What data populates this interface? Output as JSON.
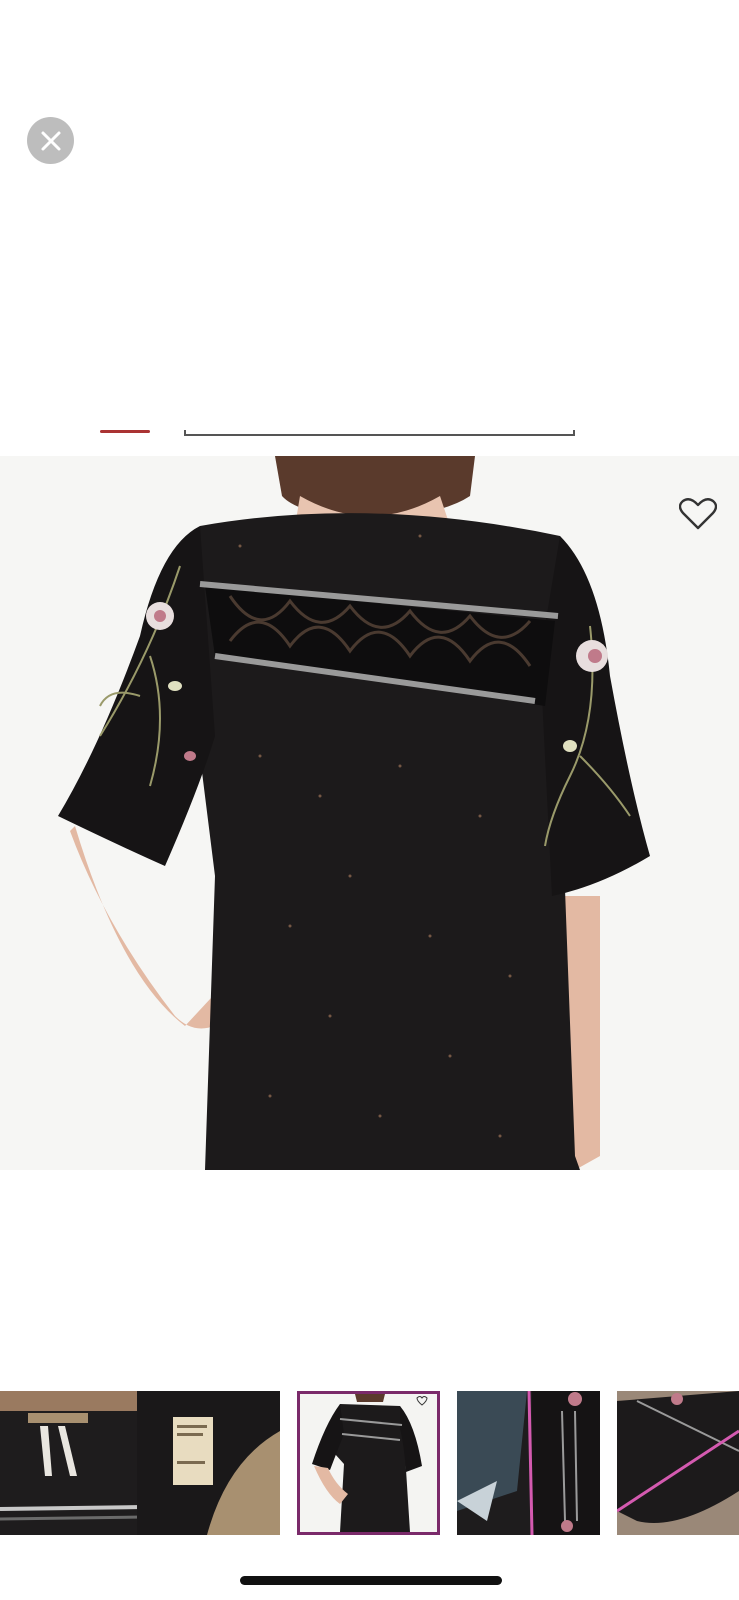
{
  "viewer": {
    "close_icon": "close-icon",
    "favorite_icon": "heart-outline-icon",
    "selected_thumbnail_index": 2,
    "thumbnail_count": 5
  },
  "colors": {
    "close_button_bg": "#bdbdbd",
    "selected_border": "#7a2a6a",
    "home_indicator": "#111111"
  }
}
